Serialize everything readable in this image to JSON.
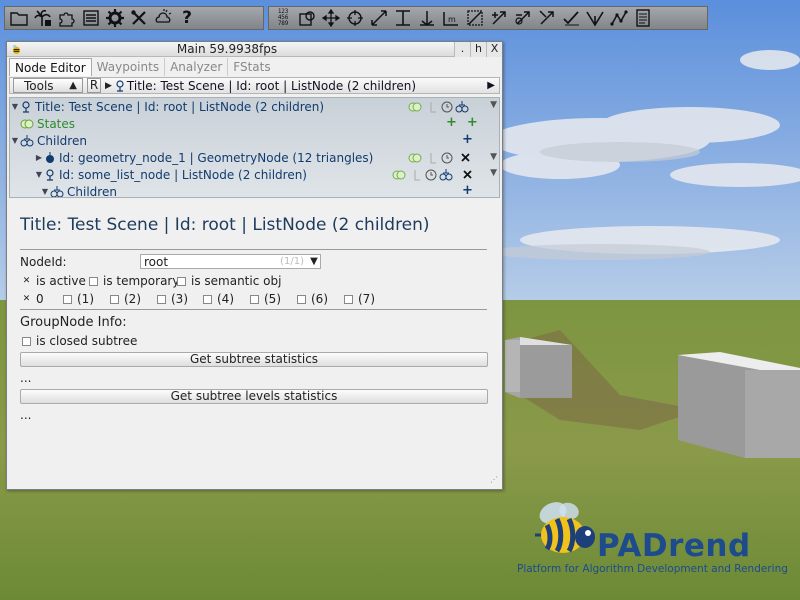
{
  "window": {
    "title": "Main 59.9938fps",
    "buttons": [
      ".",
      "h",
      "X"
    ]
  },
  "toolbar_left": {
    "icons": [
      "folder-icon",
      "palm-tree-icon",
      "puzzle-icon",
      "list-icon",
      "gear-icon",
      "tools-icon",
      "weather-icon"
    ],
    "help_label": "?"
  },
  "toolbar_right": {
    "grid_icon": "1 2 3 4 5 6 7 8 9",
    "icons": [
      "node-transform-icon",
      "move-icon",
      "rotate-icon",
      "scale-icon",
      "align-icon",
      "anchor-icon",
      "text-icon",
      "select-icon",
      "select-add-icon",
      "select-remove-icon",
      "select-tool-icon",
      "check-icon",
      "angle-icon",
      "path-icon",
      "notepad-icon"
    ]
  },
  "tabs": [
    "Node Editor",
    "Waypoints",
    "Analyzer",
    "FStats"
  ],
  "crumbbar": {
    "tools_label": "Tools",
    "r_label": "R",
    "crumb_text": "Title: Test Scene | Id: root | ListNode (2 children)"
  },
  "tree": {
    "rows": [
      {
        "label": "Title: Test Scene | Id: root | ListNode (2 children)"
      },
      {
        "label": "States"
      },
      {
        "label": "Children"
      },
      {
        "label": "Id: geometry_node_1 | GeometryNode (12 triangles)"
      },
      {
        "label": "Id: some_list_node | ListNode (2 children)"
      },
      {
        "label": "Children"
      }
    ]
  },
  "panel": {
    "title": "Title: Test Scene | Id: root | ListNode (2 children)",
    "nodeid_label": "NodeId:",
    "nodeid_value": "root",
    "nodeid_count": "(1/1)",
    "flags": [
      {
        "label": "is active",
        "checked": true
      },
      {
        "label": "is temporary",
        "checked": false
      },
      {
        "label": "is semantic obj",
        "checked": false
      }
    ],
    "render_flags": [
      {
        "label": "0",
        "checked": true
      },
      {
        "label": "(1)",
        "checked": false
      },
      {
        "label": "(2)",
        "checked": false
      },
      {
        "label": "(3)",
        "checked": false
      },
      {
        "label": "(4)",
        "checked": false
      },
      {
        "label": "(5)",
        "checked": false
      },
      {
        "label": "(6)",
        "checked": false
      },
      {
        "label": "(7)",
        "checked": false
      }
    ],
    "group_info_label": "GroupNode Info:",
    "closed_subtree_label": "is closed subtree",
    "subtree_stats_button": "Get subtree statistics",
    "ellipsis1": "...",
    "subtree_levels_button": "Get subtree levels statistics",
    "ellipsis2": "..."
  },
  "logo": {
    "title": "PADrend",
    "subtitle": "Platform for Algorithm Development and Rendering"
  },
  "colors": {
    "sky": "#7fa9e2",
    "ground": "#6f8a3b",
    "tree_text": "#123b6e",
    "states_text": "#2e8b2e",
    "logo_blue": "#1d4b8d"
  }
}
